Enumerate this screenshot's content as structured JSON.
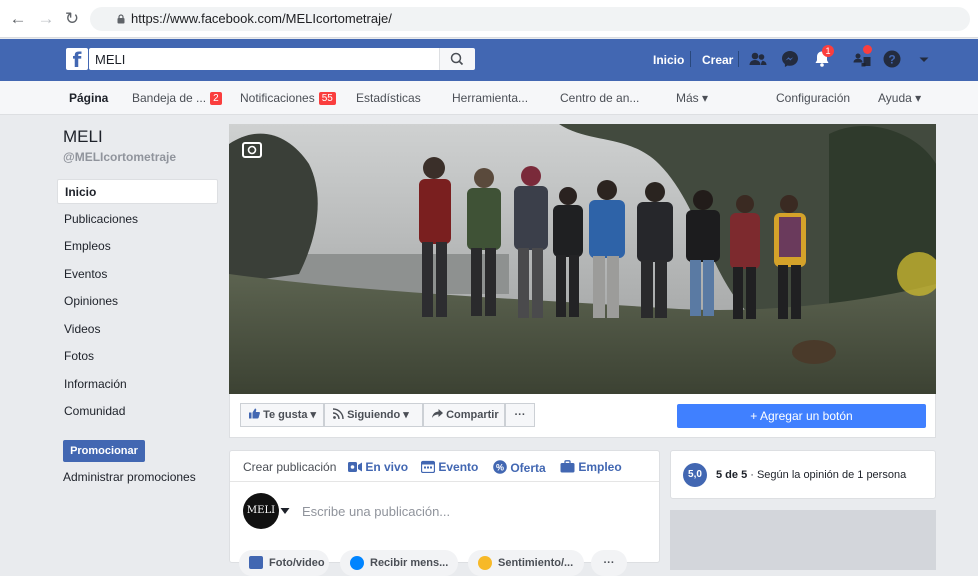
{
  "browser": {
    "url": "https://www.facebook.com/MELIcortometraje/"
  },
  "topbar": {
    "search_value": "MELI",
    "home_label": "Inicio",
    "create_label": "Crear",
    "notifications_badge": "1"
  },
  "tabs": [
    {
      "label": "Página",
      "badge": ""
    },
    {
      "label": "Bandeja de ...",
      "badge": "2"
    },
    {
      "label": "Notificaciones",
      "badge": "55"
    },
    {
      "label": "Estadísticas",
      "badge": ""
    },
    {
      "label": "Herramienta...",
      "badge": ""
    },
    {
      "label": "Centro de an...",
      "badge": ""
    },
    {
      "label": "Más ▾",
      "badge": ""
    },
    {
      "label": "Configuración",
      "badge": ""
    },
    {
      "label": "Ayuda ▾",
      "badge": ""
    }
  ],
  "page": {
    "name": "MELI",
    "handle": "@MELIcortometraje"
  },
  "sidebar": {
    "items": [
      {
        "label": "Inicio"
      },
      {
        "label": "Publicaciones"
      },
      {
        "label": "Empleos"
      },
      {
        "label": "Eventos"
      },
      {
        "label": "Opiniones"
      },
      {
        "label": "Videos"
      },
      {
        "label": "Fotos"
      },
      {
        "label": "Información"
      },
      {
        "label": "Comunidad"
      }
    ],
    "promote_label": "Promocionar",
    "admin_promos_label": "Administrar promociones"
  },
  "actions": {
    "like_label": "Te gusta ▾",
    "follow_label": "Siguiendo ▾",
    "share_label": "Compartir",
    "more_label": "···",
    "add_button_label": "+ Agregar un botón"
  },
  "composer": {
    "tabs": [
      {
        "label": "Crear publicación"
      },
      {
        "label": "En vivo"
      },
      {
        "label": "Evento"
      },
      {
        "label": "Oferta"
      },
      {
        "label": "Empleo"
      }
    ],
    "placeholder": "Escribe una publicación...",
    "avatar_text": "MELI",
    "bottom_buttons": [
      {
        "label": "Foto/video"
      },
      {
        "label": "Recibir mens..."
      },
      {
        "label": "Sentimiento/..."
      },
      {
        "label": "···"
      }
    ]
  },
  "rating": {
    "score": "5,0",
    "text_bold": "5 de 5",
    "text_rest": " · Según la opinión de 1 persona"
  },
  "colors": {
    "facebook_blue": "#4267b2",
    "add_button_blue": "#4080ff",
    "badge_red": "#fa3e3e"
  }
}
